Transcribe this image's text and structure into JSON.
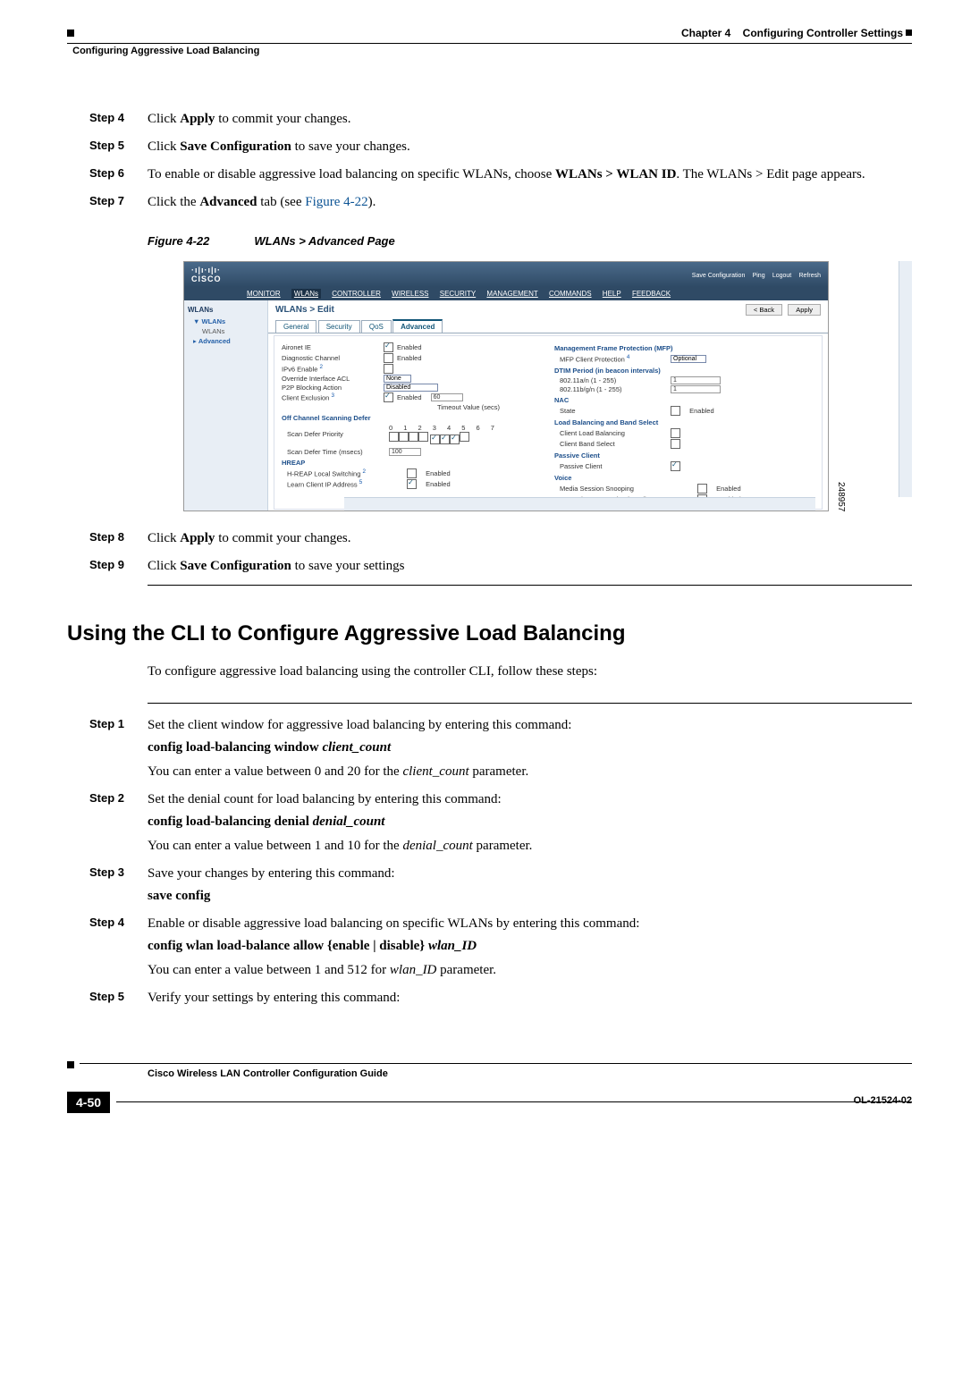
{
  "header": {
    "chapter_label": "Chapter 4",
    "chapter_title": "Configuring Controller Settings",
    "section_title": "Configuring Aggressive Load Balancing"
  },
  "steps_top": [
    {
      "n": "Step 4",
      "html": "Click <b>Apply</b> to commit your changes."
    },
    {
      "n": "Step 5",
      "html": "Click <b>Save Configuration</b> to save your changes."
    },
    {
      "n": "Step 6",
      "html": "To enable or disable aggressive load balancing on specific WLANs, choose <b>WLANs > WLAN ID</b>. The WLANs > Edit page appears."
    },
    {
      "n": "Step 7",
      "html": "Click the <b>Advanced</b> tab (see <span class='link'>Figure 4-22</span>)."
    }
  ],
  "figure": {
    "label": "Figure 4-22",
    "title": "WLANs > Advanced Page",
    "image_id": "248957",
    "top_links": [
      "Save Configuration",
      "Ping",
      "Logout",
      "Refresh"
    ],
    "menu": [
      "MONITOR",
      "WLANs",
      "CONTROLLER",
      "WIRELESS",
      "SECURITY",
      "MANAGEMENT",
      "COMMANDS",
      "HELP",
      "FEEDBACK"
    ],
    "sidebar": {
      "heading": "WLANs",
      "items": [
        "WLANs",
        "WLANs",
        "Advanced"
      ]
    },
    "page_title": "WLANs > Edit",
    "buttons": {
      "back": "< Back",
      "apply": "Apply"
    },
    "tabs": [
      "General",
      "Security",
      "QoS",
      "Advanced"
    ],
    "left_fields": {
      "aironet": "Aironet IE",
      "aironet_v": "Enabled",
      "diag": "Diagnostic Channel",
      "diag_en": "Enabled",
      "ipv6": "IPv6 Enable",
      "override": "Override Interface ACL",
      "override_v": "None",
      "p2p": "P2P Blocking Action",
      "p2p_v": "Disabled",
      "exclusion": "Client Exclusion",
      "exclusion_en": "Enabled",
      "exclusion_val": "60",
      "exclusion_hint": "Timeout Value (secs)",
      "off_ch": "Off Channel Scanning Defer",
      "scan_pri": "Scan Defer Priority",
      "scan_time": "Scan Defer Time (msecs)",
      "scan_time_v": "100",
      "hreap": "HREAP",
      "hreap_local": "H-REAP Local Switching",
      "hreap_local_en": "Enabled",
      "learn_ip": "Learn Client IP Address",
      "learn_ip_en": "Enabled"
    },
    "right_fields": {
      "mfp": "Management Frame Protection (MFP)",
      "mfp_client": "MFP Client Protection",
      "mfp_v": "Optional",
      "dtim": "DTIM Period (in beacon intervals)",
      "n80211a": "802.11a/n (1 - 255)",
      "n80211a_v": "1",
      "n80211b": "802.11b/g/n (1 - 255)",
      "n80211b_v": "1",
      "nac": "NAC",
      "nac_state": "State",
      "nac_en": "Enabled",
      "lb": "Load Balancing and Band Select",
      "lb_client": "Client Load Balancing",
      "lb_band": "Client Band Select",
      "passive": "Passive Client",
      "passive_c": "Passive Client",
      "voice": "Voice",
      "media": "Media Session Snooping",
      "media_en": "Enabled",
      "reanchor": "Re-anchor Roamed Voice Clients",
      "reanchor_en": "Enabled"
    }
  },
  "steps_after_fig": [
    {
      "n": "Step 8",
      "html": "Click <b>Apply</b> to commit your changes."
    },
    {
      "n": "Step 9",
      "html": "Click <b>Save Configuration</b> to save your settings"
    }
  ],
  "section_heading": "Using the CLI to Configure Aggressive Load Balancing",
  "section_intro": "To configure aggressive load balancing using the controller CLI, follow these steps:",
  "cli_steps": [
    {
      "n": "Step 1",
      "lead": "Set the client window for aggressive load balancing by entering this command:",
      "cmd": "<b>config load-balancing window</b> <i>client_count</i>",
      "after": "You can enter a value between 0 and 20 for the <i>client_count</i> parameter."
    },
    {
      "n": "Step 2",
      "lead": "Set the denial count for load balancing by entering this command:",
      "cmd": "<b>config load-balancing denial</b> <i>denial_count</i>",
      "after": "You can enter a value between 1 and 10 for the <i>denial_count</i> parameter."
    },
    {
      "n": "Step 3",
      "lead": "Save your changes by entering this command:",
      "cmd": "<b>save config</b>",
      "after": ""
    },
    {
      "n": "Step 4",
      "lead": "Enable or disable aggressive load balancing on specific WLANs by entering this command:",
      "cmd": "<b>config wlan load-balance allow</b> {<b>enable</b> | <b>disable</b>} <i>wlan_ID</i>",
      "after": "You can enter a value between 1 and 512 for <i>wlan_ID</i> parameter."
    },
    {
      "n": "Step 5",
      "lead": "Verify your settings by entering this command:",
      "cmd": "",
      "after": ""
    }
  ],
  "footer": {
    "book": "Cisco Wireless LAN Controller Configuration Guide",
    "pagenum": "4-50",
    "ol": "OL-21524-02"
  }
}
